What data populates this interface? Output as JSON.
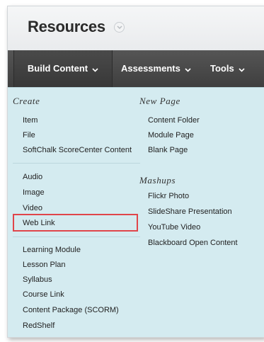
{
  "page": {
    "title": "Resources"
  },
  "menubar": {
    "tabs": [
      {
        "label": "Build Content"
      },
      {
        "label": "Assessments"
      },
      {
        "label": "Tools"
      }
    ]
  },
  "menu": {
    "create": {
      "heading": "Create",
      "group1": [
        "Item",
        "File",
        "SoftChalk ScoreCenter Content"
      ],
      "group2": [
        "Audio",
        "Image",
        "Video",
        "Web Link"
      ],
      "group3": [
        "Learning Module",
        "Lesson Plan",
        "Syllabus",
        "Course Link",
        "Content Package (SCORM)",
        "RedShelf"
      ]
    },
    "new_page": {
      "heading": "New Page",
      "items": [
        "Content Folder",
        "Module Page",
        "Blank Page"
      ]
    },
    "mashups": {
      "heading": "Mashups",
      "items": [
        "Flickr Photo",
        "SlideShare Presentation",
        "YouTube Video",
        "Blackboard Open Content"
      ]
    }
  },
  "highlighted_item": "Web Link",
  "colors": {
    "menubar": "#4a4a4a",
    "panel": "#d4ebf0",
    "highlight": "#e0454a"
  }
}
